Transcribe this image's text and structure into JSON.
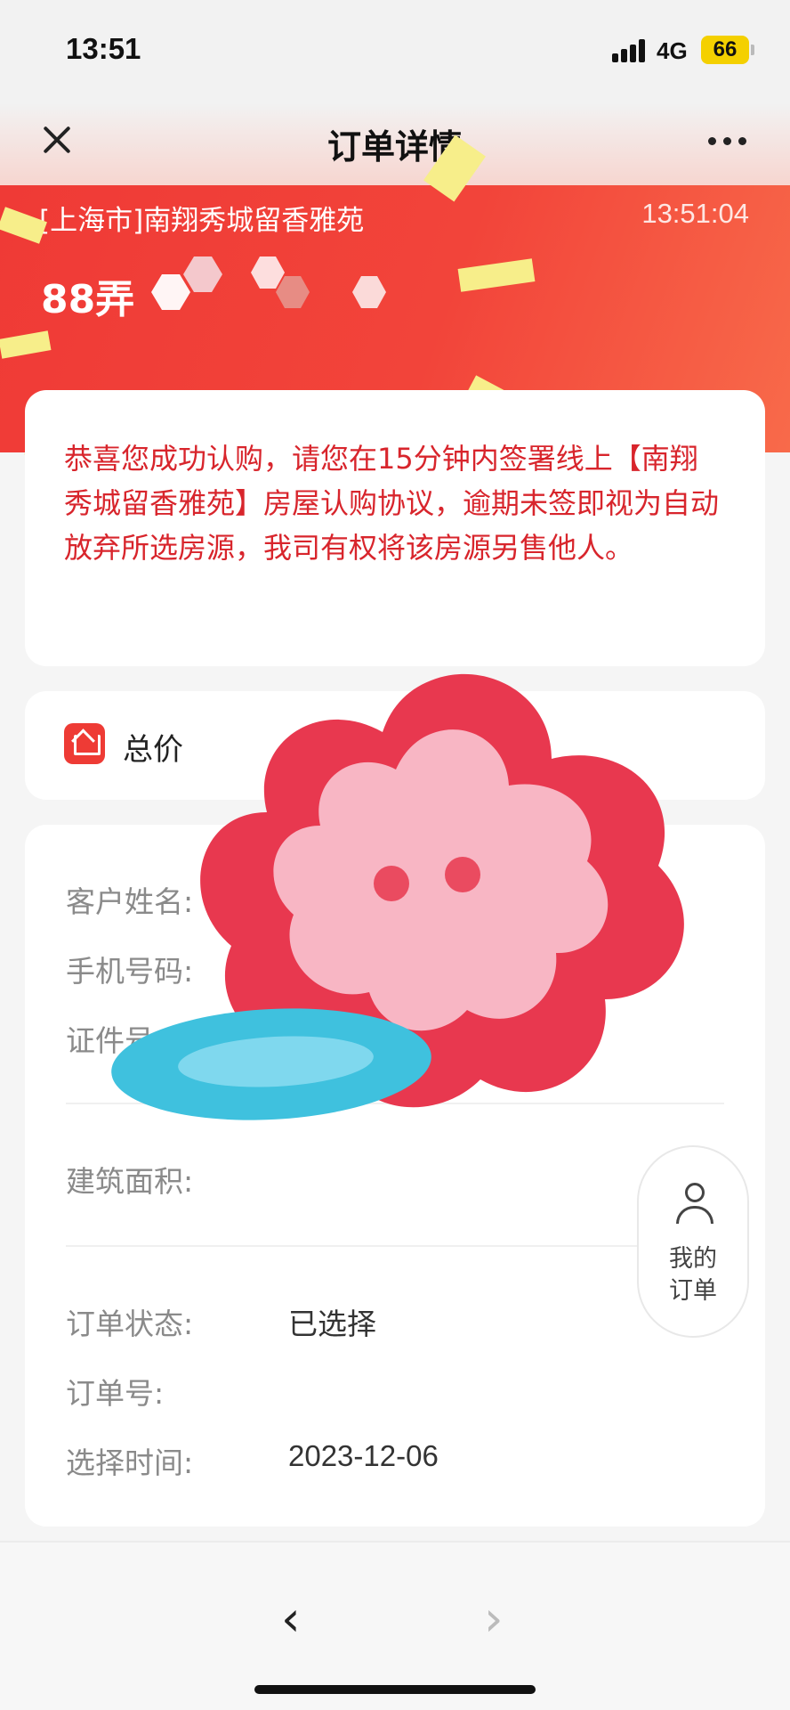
{
  "status": {
    "time": "13:51",
    "network": "4G",
    "battery": "66"
  },
  "nav": {
    "title": "订单详情"
  },
  "header": {
    "project": "[上海市]南翔秀城留香雅苑",
    "time": "13:51:04",
    "lane": "88弄"
  },
  "notice": {
    "text": "恭喜您成功认购，请您在15分钟内签署线上【南翔秀城留香雅苑】房屋认购协议，逾期未签即视为自动放弃所选房源，我司有权将该房源另售他人。"
  },
  "total": {
    "label": "总价"
  },
  "customer": {
    "name_label": "客户姓名:",
    "phone_label": "手机号码:",
    "id_label": "证件号"
  },
  "building": {
    "area_label": "建筑面积:"
  },
  "order": {
    "status_label": "订单状态:",
    "status_value": "已选择",
    "number_label": "订单号:",
    "time_label": "选择时间:",
    "time_value": "2023-12-06"
  },
  "fab": {
    "label_line1": "我的",
    "label_line2": "订单"
  },
  "colors": {
    "accent_red": "#ef3a36",
    "notice_red": "#d8252c"
  },
  "icons": [
    "close-icon",
    "more-icon",
    "house-icon",
    "user-icon",
    "back-arrow-icon",
    "forward-arrow-icon"
  ]
}
